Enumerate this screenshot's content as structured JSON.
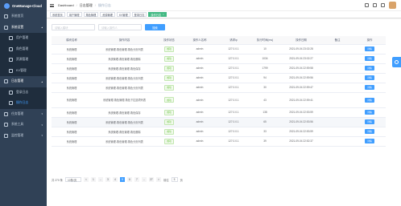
{
  "app": {
    "title": "OneManage-Cloud"
  },
  "sidebar": {
    "items": [
      {
        "label": "系统首页",
        "cls": ""
      },
      {
        "label": "系统设置",
        "cls": "open-parent",
        "arrow": "^"
      },
      {
        "label": "用户管理",
        "cls": "sub"
      },
      {
        "label": "角色管理",
        "cls": "sub"
      },
      {
        "label": "资源管理",
        "cls": "sub"
      },
      {
        "label": "KV管理",
        "cls": "sub"
      },
      {
        "label": "日志管理",
        "cls": "open-parent",
        "arrow": "^"
      },
      {
        "label": "登录日志",
        "cls": "sub"
      },
      {
        "label": "操作日志",
        "cls": "sub active"
      },
      {
        "label": "任务管理",
        "cls": "",
        "arrow": "v"
      },
      {
        "label": "系统工具",
        "cls": "",
        "arrow": "v"
      },
      {
        "label": "监控管理",
        "cls": "",
        "arrow": "v"
      }
    ]
  },
  "header": {
    "breadcrumb": [
      "Dashboard",
      "日志管理",
      "操作日志"
    ]
  },
  "tags": [
    {
      "label": "系统首页",
      "active": false
    },
    {
      "label": "用户管理",
      "active": false
    },
    {
      "label": "角色管理",
      "active": false
    },
    {
      "label": "资源管理",
      "active": false
    },
    {
      "label": "KV管理",
      "active": false
    },
    {
      "label": "登录日志",
      "active": false
    },
    {
      "label": "操作日志",
      "active": true
    }
  ],
  "search": {
    "module_placeholder": "请输入模块",
    "ip_placeholder": "请输入操作人",
    "button": "搜索"
  },
  "table": {
    "headers": [
      "模块名称",
      "操作内容",
      "操作状态",
      "操作人名称",
      "请求ip",
      "执行时间(ms)",
      "操作日期",
      "备注",
      "操作"
    ],
    "rows": [
      {
        "module": "系统管理",
        "content": "系统管理-角色管理-角色分页列表",
        "status": "成功",
        "user": "admin",
        "ip": "127.0.0.1",
        "ms": "10",
        "date": "2021-09-04 23:02:28",
        "remark": "",
        "action": "详情"
      },
      {
        "module": "系统管理",
        "content": "系统管理-角色管理-角色删除",
        "status": "成功",
        "user": "admin",
        "ip": "127.0.0.1",
        "ms": "1034",
        "date": "2021-09-04 23:02:27",
        "remark": "",
        "action": "详情"
      },
      {
        "module": "系统管理",
        "content": "系统管理-角色管理-角色保存",
        "status": "成功",
        "user": "admin",
        "ip": "127.0.0.1",
        "ms": "1799",
        "date": "2021-09-04 22:59:58",
        "remark": "",
        "action": "详情"
      },
      {
        "module": "系统管理",
        "content": "系统管理-角色管理-角色分页列表",
        "status": "成功",
        "user": "admin",
        "ip": "127.0.0.1",
        "ms": "94",
        "date": "2021-09-04 22:59:56",
        "remark": "",
        "action": "详情"
      },
      {
        "module": "系统管理",
        "content": "系统管理-角色管理-角色分页列表",
        "status": "成功",
        "user": "admin",
        "ip": "127.0.0.1",
        "ms": "30",
        "date": "2021-09-04 22:59:47",
        "remark": "",
        "action": "详情"
      },
      {
        "module": "系统管理",
        "content": "系统管理-角色管理-角色下拉选项列表",
        "status": "成功",
        "user": "admin",
        "ip": "127.0.0.1",
        "ms": "43",
        "date": "2021-09-04 22:59:41",
        "remark": "",
        "action": "详情",
        "tall": true
      },
      {
        "module": "系统管理",
        "content": "系统管理-角色管理-角色保存",
        "status": "成功",
        "user": "admin",
        "ip": "127.0.0.1",
        "ms": "138",
        "date": "2021-09-04 22:53:59",
        "remark": "",
        "action": "详情"
      },
      {
        "module": "系统管理",
        "content": "系统管理-角色管理-角色分页列表",
        "status": "成功",
        "user": "admin",
        "ip": "127.0.0.1",
        "ms": "65",
        "date": "2021-09-04 22:53:56",
        "remark": "",
        "action": "详情",
        "hl": true
      },
      {
        "module": "系统管理",
        "content": "系统管理-角色管理-角色删除",
        "status": "成功",
        "user": "admin",
        "ip": "127.0.0.1",
        "ms": "33",
        "date": "2021-09-04 22:53:59",
        "remark": "",
        "action": "详情"
      },
      {
        "module": "系统管理",
        "content": "系统管理-角色管理-角色分页列表",
        "status": "成功",
        "user": "admin",
        "ip": "127.0.0.1",
        "ms": "39",
        "date": "2021-09-04 22:52:37",
        "remark": "",
        "action": "详情"
      }
    ]
  },
  "pager": {
    "total": "共 270 条",
    "size": "10条/页",
    "pages": [
      "<",
      "1",
      "...",
      "3",
      "4",
      "5",
      "6",
      "7",
      "...",
      "27",
      ">"
    ],
    "current": "5",
    "goto_label": "前往",
    "goto_value": "5",
    "page_unit": "页"
  }
}
